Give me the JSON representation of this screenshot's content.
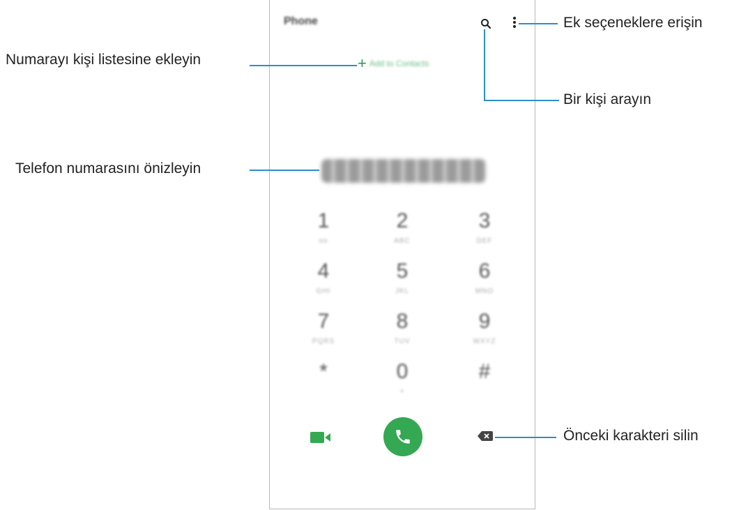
{
  "app": {
    "title": "Phone"
  },
  "add_contacts": {
    "label": "Add to Contacts"
  },
  "keypad": [
    {
      "num": "1",
      "sub": "oo"
    },
    {
      "num": "2",
      "sub": "ABC"
    },
    {
      "num": "3",
      "sub": "DEF"
    },
    {
      "num": "4",
      "sub": "GHI"
    },
    {
      "num": "5",
      "sub": "JKL"
    },
    {
      "num": "6",
      "sub": "MNO"
    },
    {
      "num": "7",
      "sub": "PQRS"
    },
    {
      "num": "8",
      "sub": "TUV"
    },
    {
      "num": "9",
      "sub": "WXYZ"
    },
    {
      "num": "*",
      "sub": ""
    },
    {
      "num": "0",
      "sub": "+"
    },
    {
      "num": "#",
      "sub": ""
    }
  ],
  "callouts": {
    "more": "Ek seçeneklere erişin",
    "add": "Numarayı kişi listesine ekleyin",
    "search": "Bir kişi arayın",
    "preview": "Telefon numarasını önizleyin",
    "backspace": "Önceki karakteri silin"
  },
  "colors": {
    "accent": "#34a853",
    "callout_line": "#2a8fc6"
  }
}
